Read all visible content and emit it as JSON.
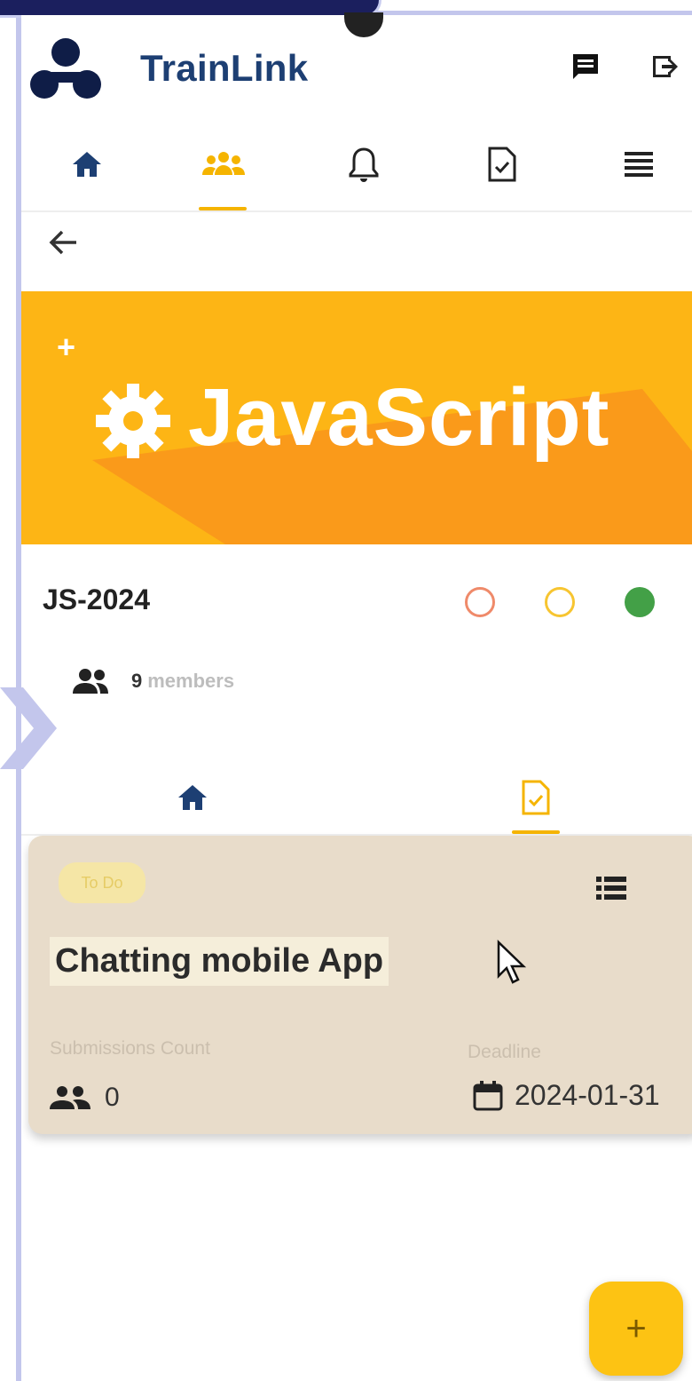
{
  "app": {
    "name": "TrainLink"
  },
  "header": {
    "icons": [
      "chat-icon",
      "logout-icon"
    ]
  },
  "nav": {
    "items": [
      "home-icon",
      "groups-icon",
      "bell-icon",
      "task-icon",
      "menu-icon"
    ],
    "active": "groups-icon"
  },
  "banner": {
    "plus": "+",
    "title": "JavaScript"
  },
  "group": {
    "code": "JS-2024",
    "status_colors": [
      "#ef8a6a",
      "#f7c531",
      "#43a047"
    ],
    "members_count": "9",
    "members_label": "members"
  },
  "subtabs": {
    "items": [
      "home-icon",
      "task-icon"
    ],
    "active": "task-icon"
  },
  "task": {
    "status": "To Do",
    "title": "Chatting mobile App",
    "submissions_label": "Submissions Count",
    "submissions_count": "0",
    "deadline_label": "Deadline",
    "deadline": "2024-01-31"
  },
  "fab": {
    "label": "+"
  },
  "colors": {
    "brand": "#1d3f73",
    "accent": "#fdb515",
    "card": "#e8dcca"
  }
}
